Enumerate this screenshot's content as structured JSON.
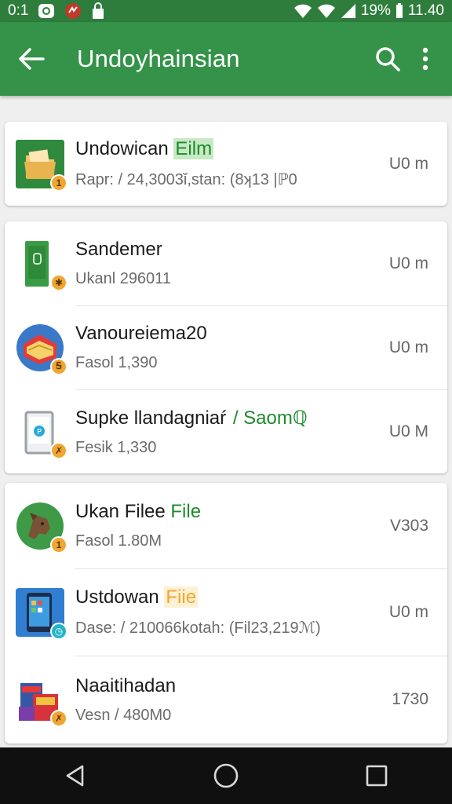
{
  "status_bar": {
    "time_left": "0:1",
    "battery": "19%",
    "clock": "11.40",
    "icons": [
      "sim-icon",
      "app-icon",
      "lock-icon",
      "wifi-icon",
      "wifi-icon",
      "signal-icon",
      "battery-icon"
    ]
  },
  "app_bar": {
    "title": "Undoyhainsian",
    "colors": {
      "status": "#2e7d3c",
      "toolbar": "#349249"
    }
  },
  "cards": [
    {
      "items": [
        {
          "icon": "folder-icon",
          "badge": "1",
          "name": "Undowican ",
          "name_highlight": "Eilm",
          "highlight_style": "green-bg",
          "sub": "Rapr: / 24,3003ǐ,stan: (8ʞ13 |ℙ0",
          "size": "U0 m"
        }
      ]
    },
    {
      "items": [
        {
          "icon": "phone-icon",
          "badge": "✱",
          "name": "Sandemer",
          "name_highlight": "",
          "highlight_style": "",
          "sub": "Ukanl 296011",
          "size": "U0 m"
        },
        {
          "icon": "book-icon",
          "badge": "Ꭶ",
          "name": "Vanoureiema20",
          "name_highlight": "",
          "highlight_style": "",
          "sub": "Fasol 1,390",
          "size": "U0 m"
        },
        {
          "icon": "tablet-icon",
          "badge": "✗",
          "name": "Supke llandagniaŕ ",
          "name_highlight": "/ Saomℚ",
          "highlight_style": "green-text",
          "sub": "Fesik 1,330",
          "size": "U0 M"
        }
      ]
    },
    {
      "items": [
        {
          "icon": "dog-icon",
          "badge": "1",
          "name": "Ukan Filee ",
          "name_highlight": "File",
          "highlight_style": "green-text",
          "sub": "Fasol 1.80M",
          "size": "V303"
        },
        {
          "icon": "smartphone-icon",
          "badge": "◷",
          "name": "Ustdowan ",
          "name_highlight": "Fiie",
          "highlight_style": "orange-text",
          "sub": "Dase: / 210066kotah: (Fil23,219ℳ)",
          "size": "U0 m"
        },
        {
          "icon": "boxes-icon",
          "badge": "✗",
          "name": "Naaitihadan",
          "name_highlight": "",
          "highlight_style": "",
          "sub": "Vesn / 480M0",
          "size": "1730"
        }
      ]
    }
  ],
  "nav_bar": {
    "buttons": [
      "back-triangle-icon",
      "home-circle-icon",
      "recents-square-icon"
    ]
  }
}
